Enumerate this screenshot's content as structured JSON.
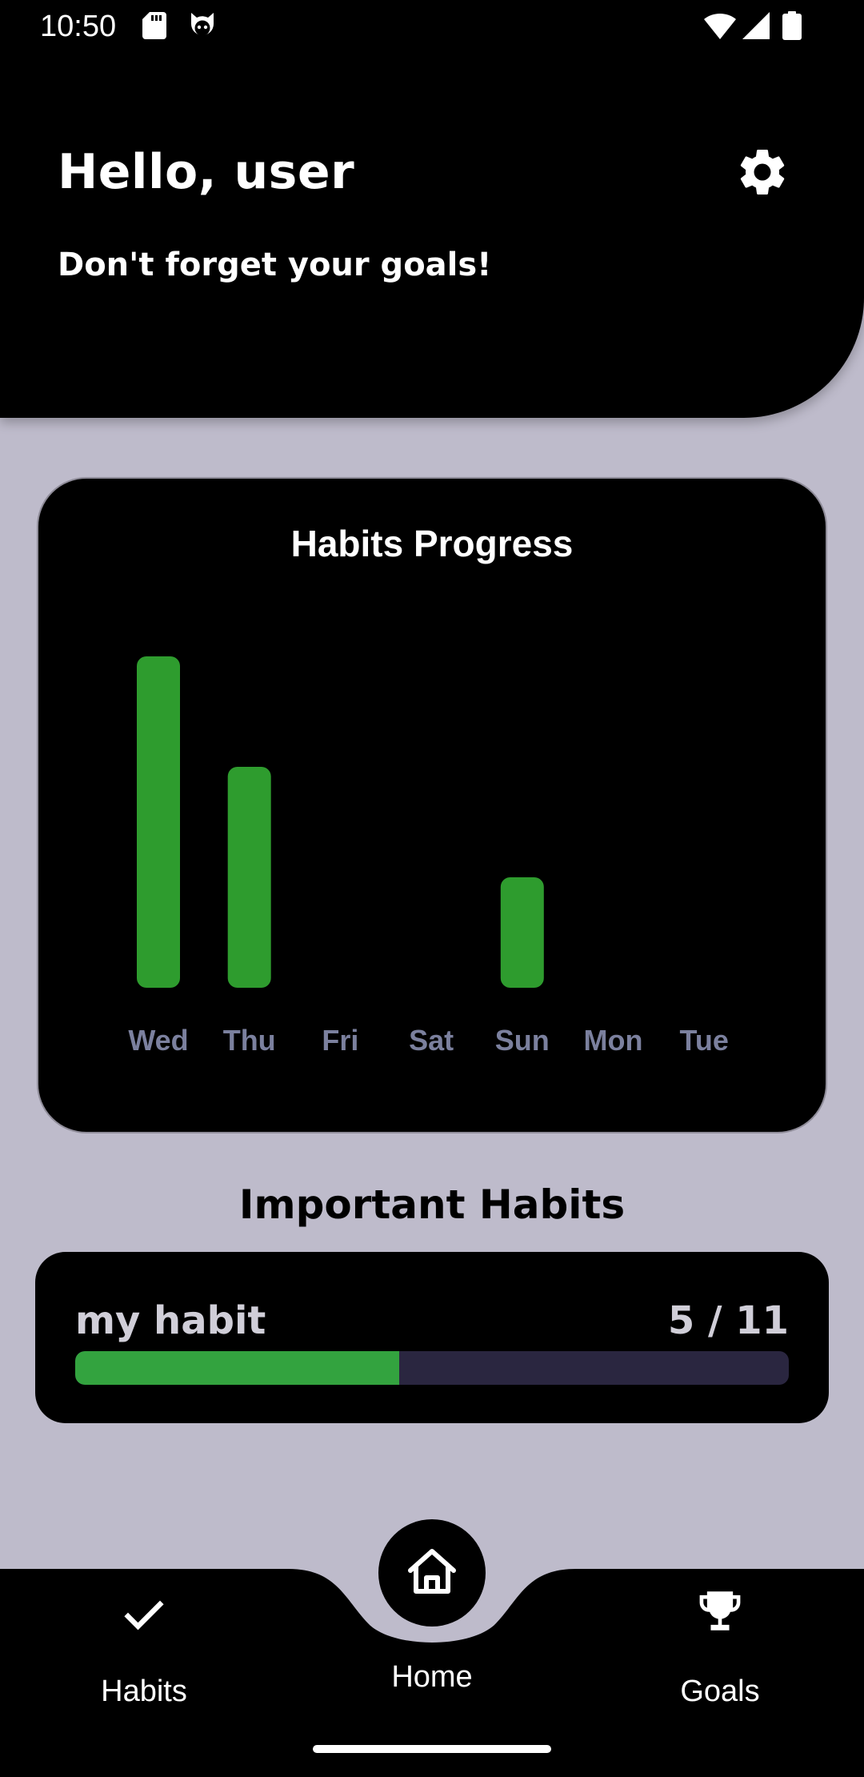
{
  "status_bar": {
    "time": "10:50",
    "left_icons": [
      "sd-card-icon",
      "cat-face-icon"
    ],
    "right_icons": [
      "wifi-icon",
      "signal-icon",
      "battery-icon"
    ]
  },
  "header": {
    "greeting": "Hello, user",
    "subtitle": "Don't forget your goals!",
    "settings_icon": "gear-icon"
  },
  "chart_card": {
    "title": "Habits Progress"
  },
  "chart_data": {
    "type": "bar",
    "title": "Habits Progress",
    "categories": [
      "Wed",
      "Thu",
      "Fri",
      "Sat",
      "Sun",
      "Mon",
      "Tue"
    ],
    "values": [
      3,
      2,
      0,
      0,
      1,
      0,
      0
    ],
    "xlabel": "",
    "ylabel": "",
    "ylim": [
      0,
      3
    ],
    "grid": false,
    "legend": "none",
    "bar_color": "#2e9c2e",
    "tick_color": "#7b809e"
  },
  "important_habits": {
    "title": "Important Habits",
    "items": [
      {
        "name": "my habit",
        "count": "5 / 11",
        "progress": 0.4545
      }
    ]
  },
  "bottom_nav": {
    "items": [
      {
        "label": "Habits",
        "icon": "checkmark-icon"
      },
      {
        "label": "Home",
        "icon": "home-icon"
      },
      {
        "label": "Goals",
        "icon": "trophy-icon"
      }
    ]
  },
  "colors": {
    "background": "#bebbcb",
    "surface": "#000000",
    "accent_green": "#33a33f",
    "track": "#2a2640"
  }
}
